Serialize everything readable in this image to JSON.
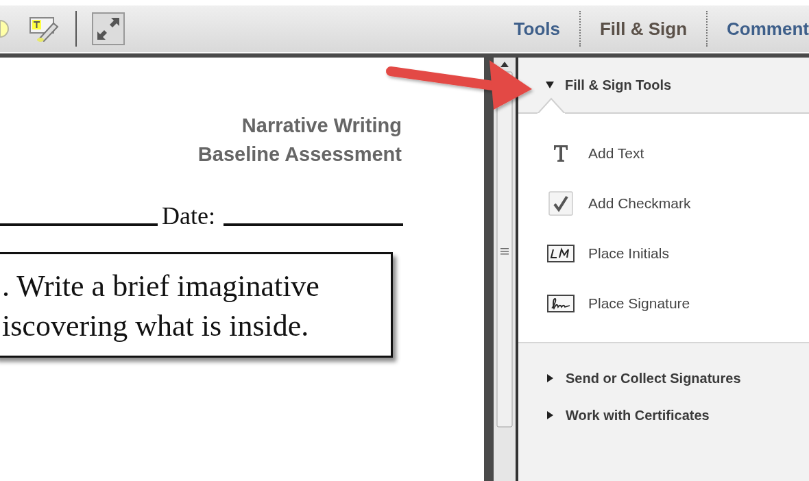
{
  "toolbar": {
    "tabs": [
      {
        "label": "Tools",
        "selected": false
      },
      {
        "label": "Fill & Sign",
        "selected": true
      },
      {
        "label": "Comment",
        "selected": false
      }
    ]
  },
  "document": {
    "title_lines": [
      "Narrative Writing",
      "Baseline Assessment"
    ],
    "date_label": "Date:",
    "prompt_lines": [
      ". Write a brief imaginative",
      "iscovering what is inside."
    ]
  },
  "panel": {
    "sections": [
      {
        "title": "Fill & Sign Tools",
        "expanded": true,
        "items": [
          {
            "label": "Add Text",
            "kind": "text"
          },
          {
            "label": "Add Checkmark",
            "kind": "checkmark"
          },
          {
            "label": "Place Initials",
            "kind": "initials"
          },
          {
            "label": "Place Signature",
            "kind": "signature"
          }
        ]
      },
      {
        "title": "Send or Collect Signatures",
        "expanded": false
      },
      {
        "title": "Work with Certificates",
        "expanded": false
      }
    ]
  }
}
